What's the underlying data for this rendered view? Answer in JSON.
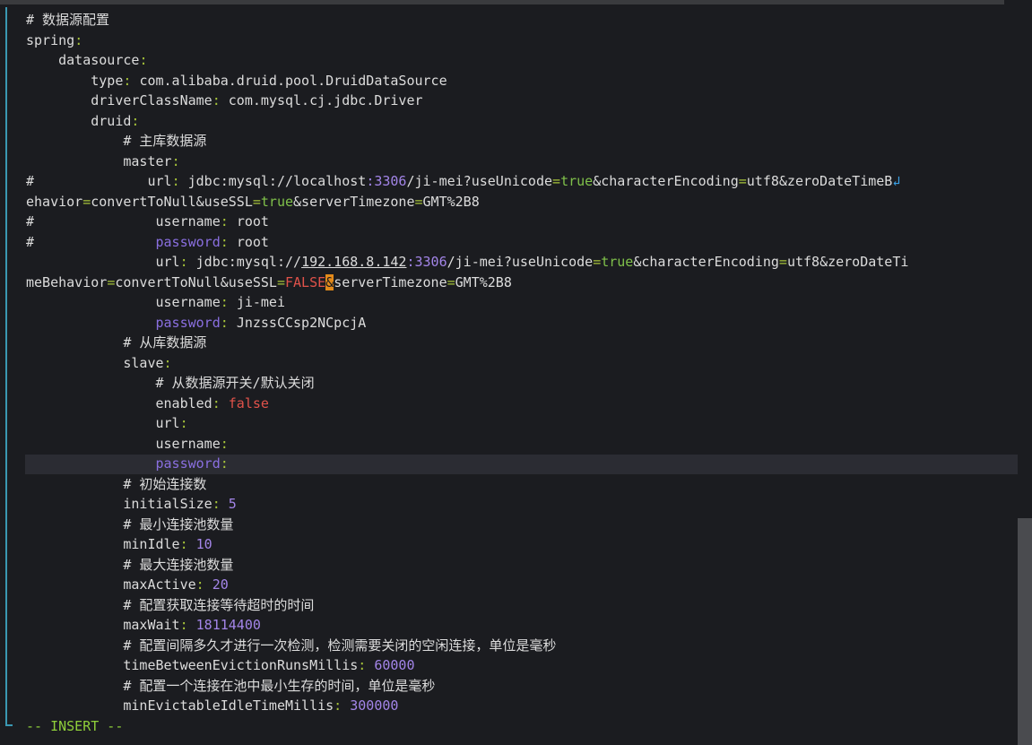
{
  "editor": {
    "lines": [
      {
        "tokens": [
          {
            "t": "# 数据源配置",
            "c": "c-comment"
          }
        ]
      },
      {
        "tokens": [
          {
            "t": "spring",
            "c": "c-key"
          },
          {
            "t": ":",
            "c": "c-punct"
          }
        ]
      },
      {
        "tokens": [
          {
            "t": "    datasource",
            "c": "c-key"
          },
          {
            "t": ":",
            "c": "c-punct"
          }
        ]
      },
      {
        "tokens": [
          {
            "t": "        type",
            "c": "c-key"
          },
          {
            "t": ": ",
            "c": "c-punct"
          },
          {
            "t": "com.alibaba.druid.pool.DruidDataSource",
            "c": "c-str"
          }
        ]
      },
      {
        "tokens": [
          {
            "t": "        driverClassName",
            "c": "c-key"
          },
          {
            "t": ": ",
            "c": "c-punct"
          },
          {
            "t": "com.mysql.cj.jdbc.Driver",
            "c": "c-str"
          }
        ]
      },
      {
        "tokens": [
          {
            "t": "        druid",
            "c": "c-key"
          },
          {
            "t": ":",
            "c": "c-punct"
          }
        ]
      },
      {
        "tokens": [
          {
            "t": "            # 主库数据源",
            "c": "c-comment"
          }
        ]
      },
      {
        "tokens": [
          {
            "t": "            master",
            "c": "c-key"
          },
          {
            "t": ":",
            "c": "c-punct"
          }
        ]
      },
      {
        "tokens": [
          {
            "t": "#              url",
            "c": "c-key"
          },
          {
            "t": ": ",
            "c": "c-punct"
          },
          {
            "t": "jdbc:mysql://localhost",
            "c": "c-url"
          },
          {
            "t": ":3306",
            "c": "c-num"
          },
          {
            "t": "/ji-mei?useUnicode",
            "c": "c-url"
          },
          {
            "t": "=",
            "c": "c-punct"
          },
          {
            "t": "true",
            "c": "c-bool"
          },
          {
            "t": "&characterEncoding",
            "c": "c-url"
          },
          {
            "t": "=",
            "c": "c-punct"
          },
          {
            "t": "utf8",
            "c": "c-url"
          },
          {
            "t": "&zeroDateTimeB",
            "c": "c-url"
          },
          {
            "t": "↲",
            "c": "wrap-mark"
          }
        ]
      },
      {
        "tokens": [
          {
            "t": "ehavior",
            "c": "c-url"
          },
          {
            "t": "=",
            "c": "c-punct"
          },
          {
            "t": "convertToNull&useSSL",
            "c": "c-url"
          },
          {
            "t": "=",
            "c": "c-punct"
          },
          {
            "t": "true",
            "c": "c-bool"
          },
          {
            "t": "&serverTimezone",
            "c": "c-url"
          },
          {
            "t": "=",
            "c": "c-punct"
          },
          {
            "t": "GMT%2B8",
            "c": "c-url"
          }
        ]
      },
      {
        "tokens": [
          {
            "t": "#               username",
            "c": "c-key"
          },
          {
            "t": ": ",
            "c": "c-punct"
          },
          {
            "t": "root",
            "c": "c-str"
          }
        ]
      },
      {
        "tokens": [
          {
            "t": "#               ",
            "c": "c-key"
          },
          {
            "t": "password",
            "c": "c-blue"
          },
          {
            "t": ": ",
            "c": "c-punct"
          },
          {
            "t": "root",
            "c": "c-str"
          }
        ]
      },
      {
        "tokens": [
          {
            "t": "                url",
            "c": "c-key"
          },
          {
            "t": ": ",
            "c": "c-punct"
          },
          {
            "t": "jdbc:mysql://",
            "c": "c-url"
          },
          {
            "t": "192.168.8.142",
            "c": "c-url c-ul"
          },
          {
            "t": ":3306",
            "c": "c-num"
          },
          {
            "t": "/ji-mei?useUnicode",
            "c": "c-url"
          },
          {
            "t": "=",
            "c": "c-punct"
          },
          {
            "t": "true",
            "c": "c-bool"
          },
          {
            "t": "&characterEncoding",
            "c": "c-url"
          },
          {
            "t": "=",
            "c": "c-punct"
          },
          {
            "t": "utf8",
            "c": "c-url"
          },
          {
            "t": "&zeroDateTi",
            "c": "c-url"
          }
        ]
      },
      {
        "tokens": [
          {
            "t": "meBehavior",
            "c": "c-url"
          },
          {
            "t": "=",
            "c": "c-punct"
          },
          {
            "t": "convertToNull&useSSL",
            "c": "c-url"
          },
          {
            "t": "=",
            "c": "c-punct"
          },
          {
            "t": "FALSE",
            "c": "c-false"
          },
          {
            "t": "&",
            "c": "cursor-block"
          },
          {
            "t": "serverTimezone",
            "c": "c-url"
          },
          {
            "t": "=",
            "c": "c-punct"
          },
          {
            "t": "GMT%2B8",
            "c": "c-url"
          }
        ]
      },
      {
        "tokens": [
          {
            "t": "                username",
            "c": "c-key"
          },
          {
            "t": ": ",
            "c": "c-punct"
          },
          {
            "t": "ji-mei",
            "c": "c-str"
          }
        ]
      },
      {
        "tokens": [
          {
            "t": "                ",
            "c": "c-key"
          },
          {
            "t": "password",
            "c": "c-blue"
          },
          {
            "t": ": ",
            "c": "c-punct"
          },
          {
            "t": "JnzssCCsp2NCpcjA",
            "c": "c-str"
          }
        ]
      },
      {
        "tokens": [
          {
            "t": "            # 从库数据源",
            "c": "c-comment"
          }
        ]
      },
      {
        "tokens": [
          {
            "t": "            slave",
            "c": "c-key"
          },
          {
            "t": ":",
            "c": "c-punct"
          }
        ]
      },
      {
        "tokens": [
          {
            "t": "                # 从数据源开关/默认关闭",
            "c": "c-comment"
          }
        ]
      },
      {
        "tokens": [
          {
            "t": "                enabled",
            "c": "c-key"
          },
          {
            "t": ": ",
            "c": "c-punct"
          },
          {
            "t": "false",
            "c": "c-false"
          }
        ]
      },
      {
        "tokens": [
          {
            "t": "                url",
            "c": "c-key"
          },
          {
            "t": ":",
            "c": "c-punct"
          }
        ]
      },
      {
        "tokens": [
          {
            "t": "                username",
            "c": "c-key"
          },
          {
            "t": ":",
            "c": "c-punct"
          }
        ]
      },
      {
        "tokens": [
          {
            "t": "                ",
            "c": "c-key"
          },
          {
            "t": "password",
            "c": "c-blue"
          },
          {
            "t": ":",
            "c": "c-punct"
          }
        ]
      },
      {
        "tokens": [
          {
            "t": "            # 初始连接数",
            "c": "c-comment"
          }
        ]
      },
      {
        "tokens": [
          {
            "t": "            initialSize",
            "c": "c-key"
          },
          {
            "t": ": ",
            "c": "c-punct"
          },
          {
            "t": "5",
            "c": "c-num"
          }
        ]
      },
      {
        "tokens": [
          {
            "t": "            # 最小连接池数量",
            "c": "c-comment"
          }
        ]
      },
      {
        "tokens": [
          {
            "t": "            minIdle",
            "c": "c-key"
          },
          {
            "t": ": ",
            "c": "c-punct"
          },
          {
            "t": "10",
            "c": "c-num"
          }
        ]
      },
      {
        "tokens": [
          {
            "t": "            # 最大连接池数量",
            "c": "c-comment"
          }
        ]
      },
      {
        "tokens": [
          {
            "t": "            maxActive",
            "c": "c-key"
          },
          {
            "t": ": ",
            "c": "c-punct"
          },
          {
            "t": "20",
            "c": "c-num"
          }
        ]
      },
      {
        "tokens": [
          {
            "t": "            # 配置获取连接等待超时的时间",
            "c": "c-comment"
          }
        ]
      },
      {
        "tokens": [
          {
            "t": "            maxWait",
            "c": "c-key"
          },
          {
            "t": ": ",
            "c": "c-punct"
          },
          {
            "t": "18114400",
            "c": "c-num"
          }
        ]
      },
      {
        "tokens": [
          {
            "t": "            # 配置间隔多久才进行一次检测，检测需要关闭的空闲连接，单位是毫秒",
            "c": "c-comment"
          }
        ]
      },
      {
        "tokens": [
          {
            "t": "            timeBetweenEvictionRunsMillis",
            "c": "c-key"
          },
          {
            "t": ": ",
            "c": "c-punct"
          },
          {
            "t": "60000",
            "c": "c-num"
          }
        ]
      },
      {
        "tokens": [
          {
            "t": "            # 配置一个连接在池中最小生存的时间，单位是毫秒",
            "c": "c-comment"
          }
        ]
      },
      {
        "tokens": [
          {
            "t": "            minEvictableIdleTimeMillis",
            "c": "c-key"
          },
          {
            "t": ": ",
            "c": "c-punct"
          },
          {
            "t": "300000",
            "c": "c-num"
          }
        ]
      },
      {
        "tokens": [
          {
            "t": "-- INSERT --",
            "c": "mode"
          }
        ]
      }
    ]
  }
}
